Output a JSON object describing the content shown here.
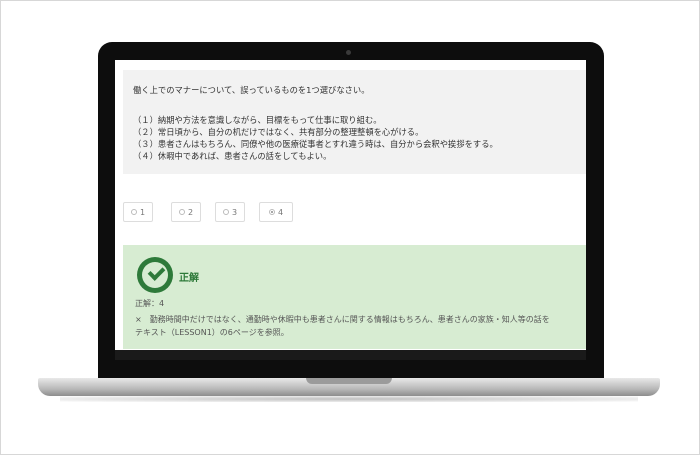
{
  "question": {
    "title": "働く上でのマナーについて、誤っているものを1つ選びなさい。",
    "options": [
      "（１）納期や方法を意識しながら、目標をもって仕事に取り組む。",
      "（２）常日頃から、自分の机だけではなく、共有部分の整理整頓を心がける。",
      "（３）患者さんはもちろん、同僚や他の医療従事者とすれ違う時は、自分から会釈や挨拶をする。",
      "（４）休暇中であれば、患者さんの話をしてもよい。"
    ]
  },
  "answers": {
    "items": [
      {
        "label": "1",
        "selected": false
      },
      {
        "label": "2",
        "selected": false
      },
      {
        "label": "3",
        "selected": false
      },
      {
        "label": "4",
        "selected": true
      }
    ]
  },
  "result": {
    "title": "正解",
    "answer": "正解：4",
    "explanation": "×　勤務時間中だけではなく、通勤時や休暇中も患者さんに関する情報はもちろん、患者さんの家族・知人等の話を",
    "reference": "テキスト（LESSON1）の6ページを参照。",
    "icon": "check-circle-icon",
    "accent_color": "#2e7a3a",
    "background_color": "#d7ecd2"
  }
}
